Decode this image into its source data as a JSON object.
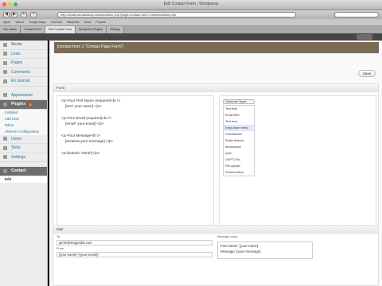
{
  "browser": {
    "title": "Edit Contact Form ‹ Wordpress",
    "url": "http://localhost:8888/wp-admin/admin.php?page=contact-form-7/admin/admin.php",
    "bookmarks": [
      "Apple",
      "Yahoo!",
      "Google Maps",
      "YouTube",
      "Wikipedia",
      "News",
      "Popular"
    ],
    "tabs": [
      "Site Admin",
      "Contact Form",
      "Edit Contact Form",
      "Wordpress Plugins",
      "Settings"
    ]
  },
  "sidebar": {
    "items": [
      {
        "label": "Media"
      },
      {
        "label": "Links"
      },
      {
        "label": "Pages"
      },
      {
        "label": "Comments"
      },
      {
        "label": "Eli Journal"
      }
    ],
    "items2": [
      {
        "label": "Appearance"
      },
      {
        "label": "Plugins",
        "badge": "2"
      }
    ],
    "plugin_sub": [
      "Installed",
      "Add New",
      "Editor",
      "Akismet Configuration"
    ],
    "items3": [
      {
        "label": "Users"
      },
      {
        "label": "Tools"
      },
      {
        "label": "Settings"
      }
    ],
    "contact": "Contact",
    "contact_sub": "Edit"
  },
  "form": {
    "title_tag": "[contact-form 1 \"Contact Page Form\"]",
    "save": "Save",
    "section": "Form",
    "lines": [
      "<p>Your First Name (required)<br />",
      "    [text* your-name] </p>",
      "",
      "<p>Your Email (required)<br />",
      "    [email* your-email] </p>",
      "",
      "<p>Your Message<br />",
      "    [textarea your-message] </p>",
      "",
      "<p>[submit \"Send\"]</p>"
    ],
    "generate_tag": "Generate Tag ▾",
    "tag_menu": [
      "Text field",
      "Email field",
      "Text area",
      "Drop-down menu",
      "Checkboxes",
      "Radio buttons",
      "Acceptance",
      "Quiz",
      "CAPTCHA",
      "File upload",
      "Submit button"
    ],
    "hover_index": 3
  },
  "mail": {
    "section": "Mail",
    "to_label": "To:",
    "to_value": "jamie@stoppedia.com",
    "from_label": "From:",
    "from_value": "[your-name] <[your-email]>",
    "body_label": "Message body:",
    "body_lines": [
      "First Name: [your-name]",
      "Message: [your-message]"
    ]
  },
  "colors": {
    "accent": "#21759b",
    "admin_bar": "#464646",
    "form_header": "#7a6b52"
  }
}
